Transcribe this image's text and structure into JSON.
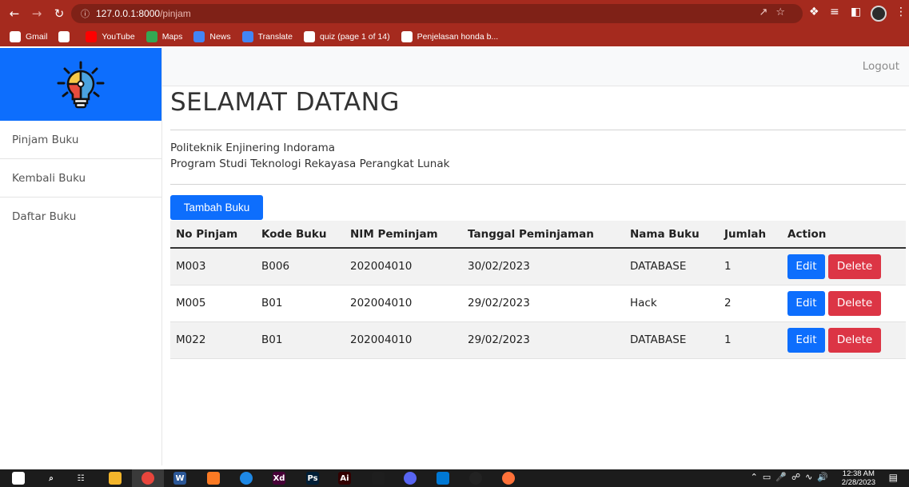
{
  "browser": {
    "url_host": "127.0.0.1:8000",
    "url_path": "/pinjam",
    "bookmarks": [
      {
        "label": "Gmail",
        "icon": "gmail-icon",
        "color": "#ffffff"
      },
      {
        "label": "",
        "icon": "globe-icon",
        "color": "#ffffff"
      },
      {
        "label": "YouTube",
        "icon": "youtube-icon",
        "color": "#ff0000"
      },
      {
        "label": "Maps",
        "icon": "maps-icon",
        "color": "#34a853"
      },
      {
        "label": "News",
        "icon": "news-icon",
        "color": "#4285f4"
      },
      {
        "label": "Translate",
        "icon": "translate-icon",
        "color": "#4285f4"
      },
      {
        "label": "quiz (page 1 of 14)",
        "icon": "quiz-icon",
        "color": "#ffffff"
      },
      {
        "label": "Penjelasan honda b...",
        "icon": "google-icon",
        "color": "#ffffff"
      }
    ]
  },
  "sidebar": {
    "items": [
      {
        "label": "Pinjam Buku"
      },
      {
        "label": "Kembali Buku"
      },
      {
        "label": "Daftar Buku"
      }
    ]
  },
  "nav": {
    "logout": "Logout"
  },
  "main": {
    "title": "SELAMAT DATANG",
    "info_line1": "Politeknik Enjinering Indorama",
    "info_line2": "Program Studi Teknologi Rekayasa Perangkat Lunak",
    "add_button": "Tambah Buku"
  },
  "table": {
    "headers": [
      "No Pinjam",
      "Kode Buku",
      "NIM Peminjam",
      "Tanggal Peminjaman",
      "Nama Buku",
      "Jumlah",
      "Action"
    ],
    "rows": [
      [
        "M003",
        "B006",
        "202004010",
        "30/02/2023",
        "DATABASE",
        "1"
      ],
      [
        "M005",
        "B01",
        "202004010",
        "29/02/2023",
        "Hack",
        "2"
      ],
      [
        "M022",
        "B01",
        "202004010",
        "29/02/2023",
        "DATABASE",
        "1"
      ]
    ],
    "edit_label": "Edit",
    "delete_label": "Delete"
  },
  "taskbar": {
    "time": "12:38 AM",
    "date": "2/28/2023"
  },
  "colors": {
    "primary": "#0d6efd",
    "danger": "#dc3545",
    "chrome": "#a52a1e"
  }
}
